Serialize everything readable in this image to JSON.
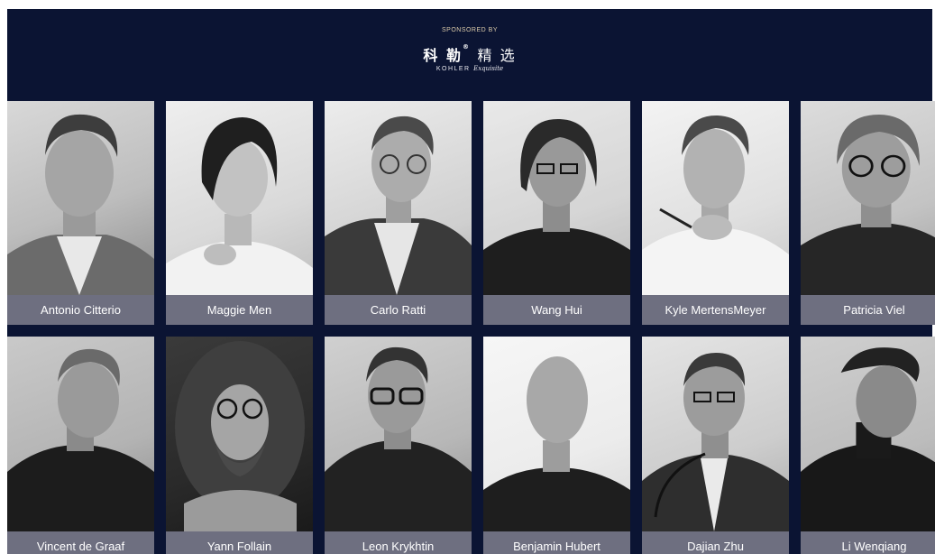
{
  "header": {
    "sponsored_label": "SPONSORED BY",
    "logo_chinese_bold": "科 勒",
    "logo_chinese_light": "精 选",
    "logo_registered": "®",
    "logo_english": "KOHLER",
    "logo_script": "Exquisite"
  },
  "speakers_row1": [
    {
      "name": "Antonio Citterio"
    },
    {
      "name": "Maggie Men"
    },
    {
      "name": "Carlo Ratti"
    },
    {
      "name": "Wang Hui"
    },
    {
      "name": "Kyle MertensMeyer"
    },
    {
      "name": "Patricia Viel"
    }
  ],
  "speakers_row2": [
    {
      "name": "Vincent de Graaf"
    },
    {
      "name": "Yann Follain"
    },
    {
      "name": "Leon Krykhtin"
    },
    {
      "name": "Benjamin Hubert"
    },
    {
      "name": "Dajian Zhu"
    },
    {
      "name": "Li Wenqiang"
    }
  ],
  "colors": {
    "background": "#0b1433",
    "name_bar": "#6e6f80",
    "sponsor_text": "#d8c8a8"
  }
}
